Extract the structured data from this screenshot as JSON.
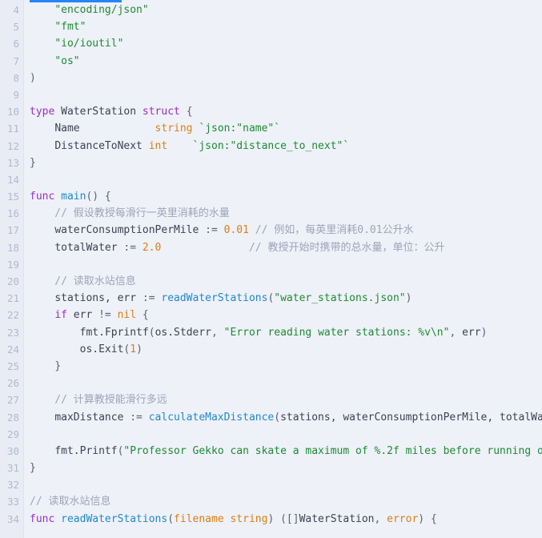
{
  "editor": {
    "language": "Go",
    "theme": "light",
    "background_color": "#eef1f8",
    "gutter_color": "#e9ecf5",
    "selection_color": "#2684f5",
    "first_visible_line": 4,
    "last_visible_line": 34,
    "colors": {
      "keyword": "#9a2fc4",
      "function": "#2189c8",
      "type": "#d98014",
      "number": "#d98014",
      "string": "#1f8a33",
      "comment": "#9ea4b8",
      "identifier": "#3b4252",
      "line_number": "#b3b9cc"
    }
  },
  "code_lines": [
    {
      "number": "4",
      "text": "    \"encoding/json\""
    },
    {
      "number": "5",
      "text": "    \"fmt\""
    },
    {
      "number": "6",
      "text": "    \"io/ioutil\""
    },
    {
      "number": "7",
      "text": "    \"os\""
    },
    {
      "number": "8",
      "text": ")"
    },
    {
      "number": "9",
      "text": ""
    },
    {
      "number": "10",
      "text": "type WaterStation struct {"
    },
    {
      "number": "11",
      "text": "    Name            string `json:\"name\"`"
    },
    {
      "number": "12",
      "text": "    DistanceToNext int    `json:\"distance_to_next\"`"
    },
    {
      "number": "13",
      "text": "}"
    },
    {
      "number": "14",
      "text": ""
    },
    {
      "number": "15",
      "text": "func main() {"
    },
    {
      "number": "16",
      "text": "    // 假设教授每滑行一英里消耗的水量"
    },
    {
      "number": "17",
      "text": "    waterConsumptionPerMile := 0.01 // 例如，每英里消耗0.01公升水"
    },
    {
      "number": "18",
      "text": "    totalWater := 2.0              // 教授开始时携带的总水量，单位：公升"
    },
    {
      "number": "19",
      "text": ""
    },
    {
      "number": "20",
      "text": "    // 读取水站信息"
    },
    {
      "number": "21",
      "text": "    stations, err := readWaterStations(\"water_stations.json\")"
    },
    {
      "number": "22",
      "text": "    if err != nil {"
    },
    {
      "number": "23",
      "text": "        fmt.Fprintf(os.Stderr, \"Error reading water stations: %v\\n\", err)"
    },
    {
      "number": "24",
      "text": "        os.Exit(1)"
    },
    {
      "number": "25",
      "text": "    }"
    },
    {
      "number": "26",
      "text": ""
    },
    {
      "number": "27",
      "text": "    // 计算教授能滑行多远"
    },
    {
      "number": "28",
      "text": "    maxDistance := calculateMaxDistance(stations, waterConsumptionPerMile, totalWater"
    },
    {
      "number": "29",
      "text": ""
    },
    {
      "number": "30",
      "text": "    fmt.Printf(\"Professor Gekko can skate a maximum of %.2f miles before running out"
    },
    {
      "number": "31",
      "text": "}"
    },
    {
      "number": "32",
      "text": ""
    },
    {
      "number": "33",
      "text": "// 读取水站信息"
    },
    {
      "number": "34",
      "text": "func readWaterStations(filename string) ([]WaterStation, error) {"
    }
  ]
}
